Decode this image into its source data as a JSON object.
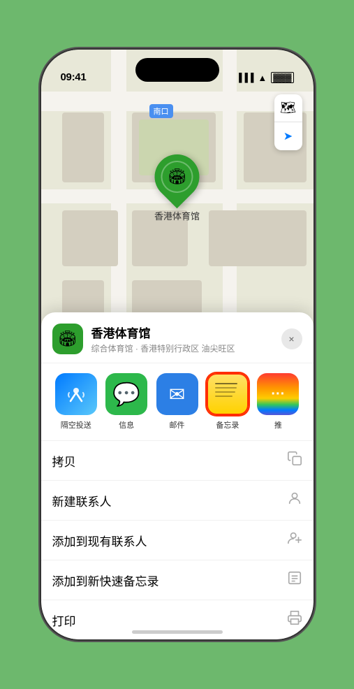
{
  "status_bar": {
    "time": "09:41",
    "location_icon": "▲"
  },
  "map": {
    "label": "南口",
    "pin_label": "香港体育馆"
  },
  "venue_card": {
    "name": "香港体育馆",
    "subtitle": "综合体育馆 · 香港特别行政区 油尖旺区",
    "close_label": "×"
  },
  "share_items": [
    {
      "id": "airdrop",
      "label": "隔空投送"
    },
    {
      "id": "messages",
      "label": "信息"
    },
    {
      "id": "mail",
      "label": "邮件"
    },
    {
      "id": "notes",
      "label": "备忘录"
    },
    {
      "id": "more",
      "label": "推"
    }
  ],
  "actions": [
    {
      "label": "拷贝",
      "icon": "⧉"
    },
    {
      "label": "新建联系人",
      "icon": "👤"
    },
    {
      "label": "添加到现有联系人",
      "icon": "👤"
    },
    {
      "label": "添加到新快速备忘录",
      "icon": "⊞"
    },
    {
      "label": "打印",
      "icon": "🖨"
    }
  ]
}
